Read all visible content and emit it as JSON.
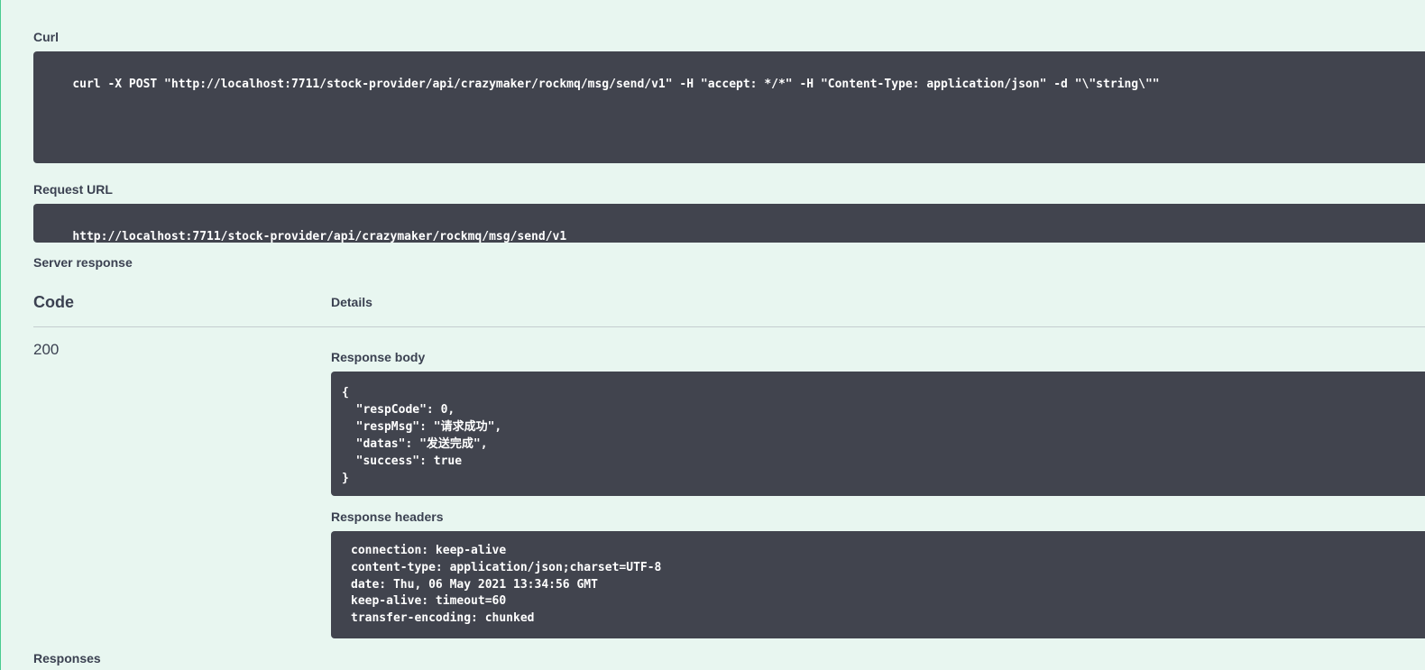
{
  "curl": {
    "label": "Curl",
    "command": "curl -X POST \"http://localhost:7711/stock-provider/api/crazymaker/rockmq/msg/send/v1\" -H \"accept: */*\" -H \"Content-Type: application/json\" -d \"\\\"string\\\"\""
  },
  "request_url": {
    "label": "Request URL",
    "value": "http://localhost:7711/stock-provider/api/crazymaker/rockmq/msg/send/v1"
  },
  "server_response": {
    "label": "Server response",
    "col_code": "Code",
    "col_details": "Details",
    "code": "200",
    "body_label": "Response body",
    "body_lines": [
      "{",
      "  \"respCode\": 0,",
      "  \"respMsg\": \"请求成功\",",
      "  \"datas\": \"发送完成\",",
      "  \"success\": true",
      "}"
    ],
    "headers_label": "Response headers",
    "header_lines": [
      "connection: keep-alive",
      "content-type: application/json;charset=UTF-8",
      "date: Thu, 06 May 2021 13:34:56 GMT",
      "keep-alive: timeout=60",
      "transfer-encoding: chunked"
    ]
  },
  "responses": {
    "label": "Responses"
  },
  "colors": {
    "background": "#e8f6f0",
    "code_bg": "#41444e",
    "accent": "#49cc90"
  }
}
